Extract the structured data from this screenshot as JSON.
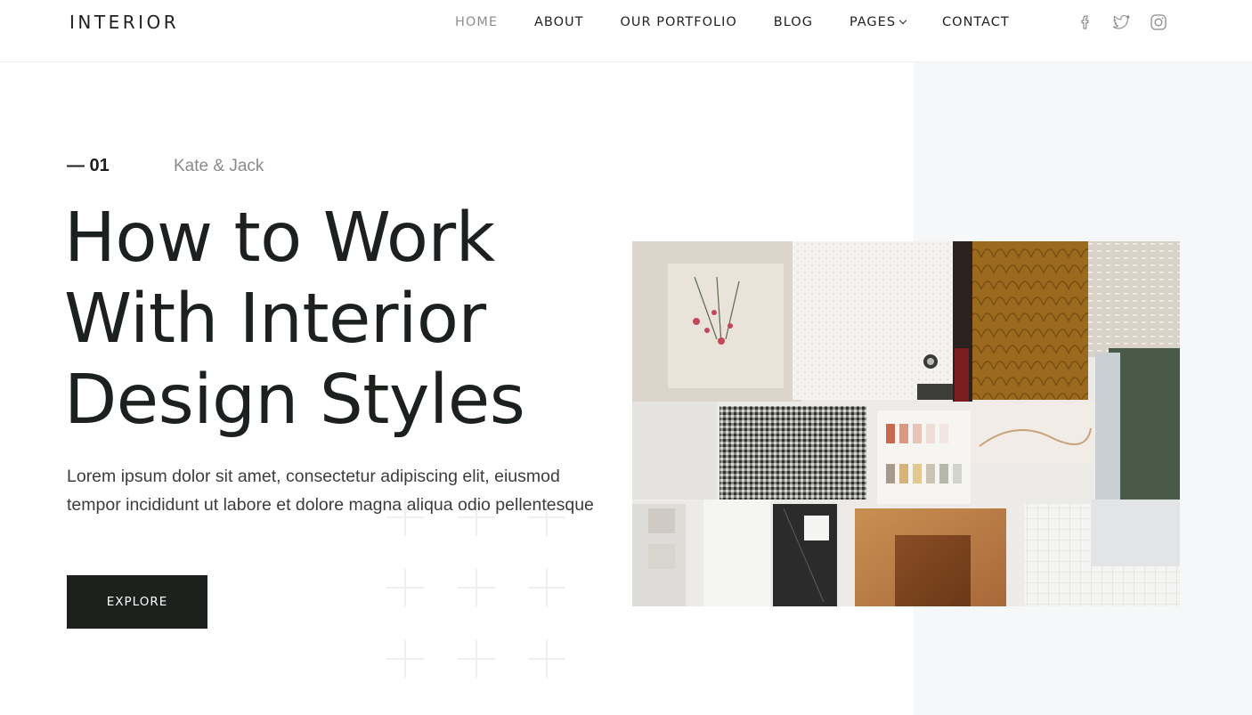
{
  "header": {
    "logo": "INTERIOR",
    "nav": [
      {
        "label": "HOME",
        "active": true
      },
      {
        "label": "ABOUT"
      },
      {
        "label": "OUR PORTFOLIO"
      },
      {
        "label": "BLOG"
      },
      {
        "label": "PAGES",
        "has_dropdown": true
      },
      {
        "label": "CONTACT"
      }
    ],
    "social_icons": [
      "facebook-icon",
      "twitter-icon",
      "instagram-icon"
    ]
  },
  "hero": {
    "slide_number": "— 01",
    "authors": "Kate & Jack",
    "title_lines": [
      "How to Work",
      "With Interior",
      "Design Styles"
    ],
    "description": "Lorem ipsum dolor sit amet, consectetur adipiscing elit, eiusmod tempor incididunt ut labore et dolore magna aliqua odio pellentesque",
    "cta_label": "EXPLORE",
    "image_alt": "material-samples-moodboard"
  },
  "colors": {
    "primary_dark": "#1d211e",
    "nav_active": "#8f8f8f",
    "muted_text": "#8a8a8a",
    "panel_bg": "#f6f7f9"
  }
}
